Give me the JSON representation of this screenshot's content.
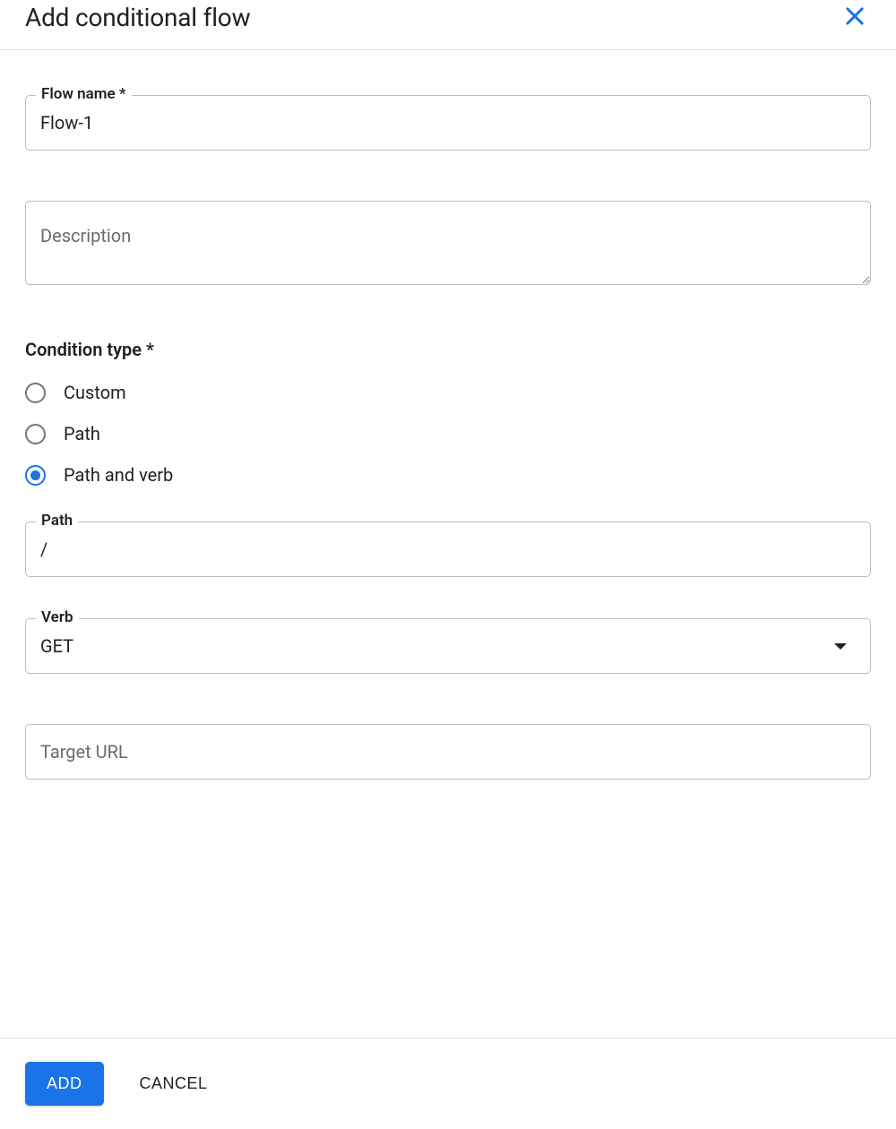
{
  "header": {
    "title": "Add conditional flow"
  },
  "form": {
    "flow_name": {
      "label": "Flow name *",
      "value": "Flow-1"
    },
    "description": {
      "placeholder": "Description",
      "value": ""
    },
    "condition_type": {
      "label": "Condition type *",
      "options": [
        {
          "label": "Custom",
          "checked": false
        },
        {
          "label": "Path",
          "checked": false
        },
        {
          "label": "Path and verb",
          "checked": true
        }
      ]
    },
    "path": {
      "label": "Path",
      "value": "/"
    },
    "verb": {
      "label": "Verb",
      "value": "GET"
    },
    "target_url": {
      "placeholder": "Target URL",
      "value": ""
    }
  },
  "footer": {
    "add_label": "ADD",
    "cancel_label": "CANCEL"
  }
}
